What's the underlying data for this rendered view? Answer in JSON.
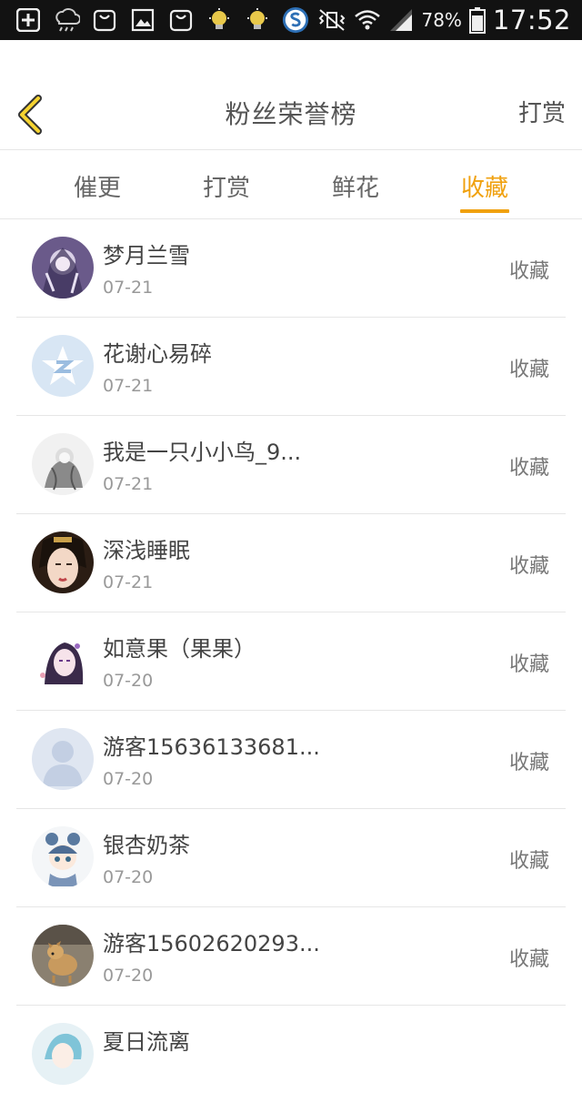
{
  "status_bar": {
    "battery": "78%",
    "time": "17:52"
  },
  "header": {
    "title": "粉丝荣誉榜",
    "right_action": "打赏"
  },
  "tabs": [
    {
      "label": "催更"
    },
    {
      "label": "打赏"
    },
    {
      "label": "鲜花"
    },
    {
      "label": "收藏",
      "active": true
    }
  ],
  "accent_color": "#f0a10f",
  "list": [
    {
      "name": "梦月兰雪",
      "date": "07-21",
      "action": "收藏",
      "avatar": "anime-avatar"
    },
    {
      "name": "花谢心易碎",
      "date": "07-21",
      "action": "收藏",
      "avatar": "default-star-avatar"
    },
    {
      "name": "我是一只小小鸟_9...",
      "date": "07-21",
      "action": "收藏",
      "avatar": "anime-avatar"
    },
    {
      "name": "深浅睡眠",
      "date": "07-21",
      "action": "收藏",
      "avatar": "portrait-avatar"
    },
    {
      "name": "如意果（果果）",
      "date": "07-20",
      "action": "收藏",
      "avatar": "anime-avatar"
    },
    {
      "name": "游客15636133681...",
      "date": "07-20",
      "action": "收藏",
      "avatar": "default-person-avatar"
    },
    {
      "name": "银杏奶茶",
      "date": "07-20",
      "action": "收藏",
      "avatar": "anime-avatar"
    },
    {
      "name": "游客15602620293...",
      "date": "07-20",
      "action": "收藏",
      "avatar": "dog-avatar"
    },
    {
      "name": "夏日流离",
      "date": "",
      "action": "",
      "avatar": "anime-avatar"
    }
  ]
}
